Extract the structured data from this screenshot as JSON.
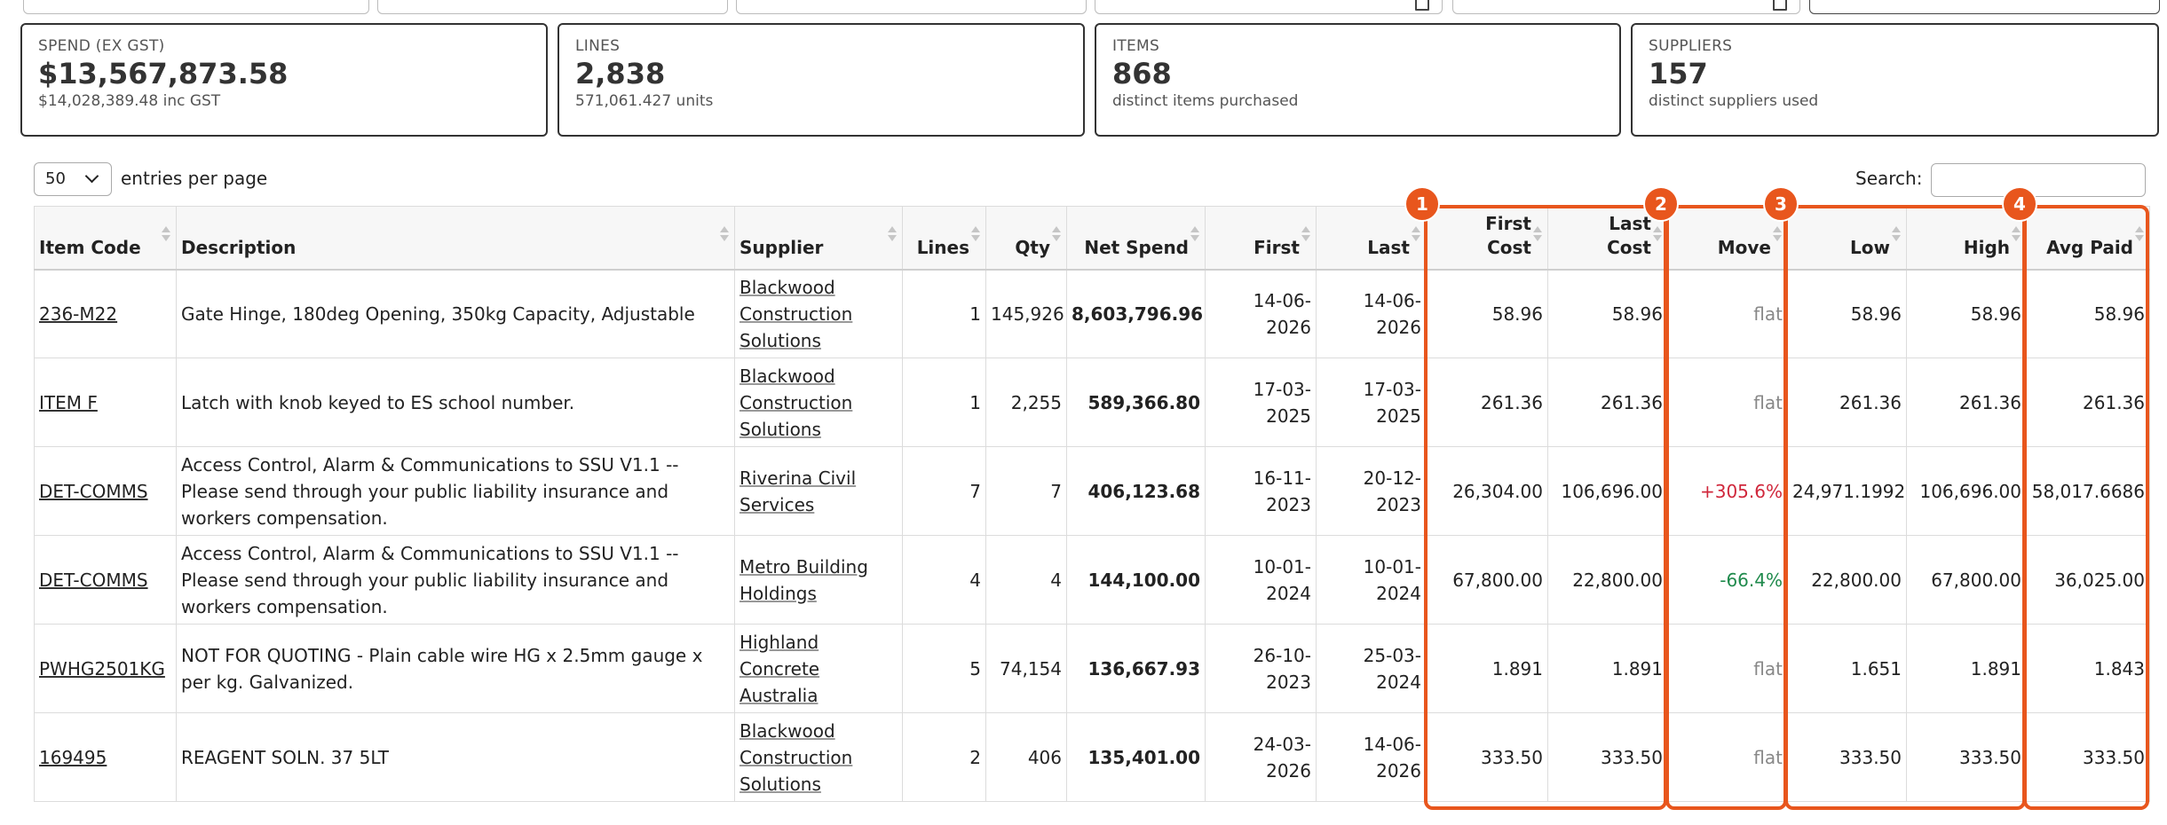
{
  "filters": [
    {
      "value": "",
      "has_calendar": false
    },
    {
      "value": "",
      "has_calendar": false
    },
    {
      "value": "",
      "has_calendar": false
    },
    {
      "value": "",
      "has_calendar": true
    },
    {
      "value": "",
      "has_calendar": true
    },
    {
      "value": "",
      "has_calendar": false
    }
  ],
  "cards": [
    {
      "label": "SPEND (EX GST)",
      "value": "$13,567,873.58",
      "sub": "$14,028,389.48 inc GST"
    },
    {
      "label": "LINES",
      "value": "2,838",
      "sub": "571,061.427 units"
    },
    {
      "label": "ITEMS",
      "value": "868",
      "sub": "distinct items purchased"
    },
    {
      "label": "SUPPLIERS",
      "value": "157",
      "sub": "distinct suppliers used"
    }
  ],
  "table_controls": {
    "page_length": "50",
    "page_length_suffix": "entries per page",
    "search_label": "Search:",
    "search_value": ""
  },
  "table": {
    "headers": [
      {
        "line1": "",
        "line2": "Item Code"
      },
      {
        "line1": "",
        "line2": "Description"
      },
      {
        "line1": "",
        "line2": "Supplier"
      },
      {
        "line1": "",
        "line2": "Lines"
      },
      {
        "line1": "",
        "line2": "Qty"
      },
      {
        "line1": "",
        "line2": "Net Spend"
      },
      {
        "line1": "",
        "line2": "First"
      },
      {
        "line1": "",
        "line2": "Last"
      },
      {
        "line1": "First",
        "line2": "Cost"
      },
      {
        "line1": "Last",
        "line2": "Cost"
      },
      {
        "line1": "",
        "line2": "Move"
      },
      {
        "line1": "",
        "line2": "Low"
      },
      {
        "line1": "",
        "line2": "High"
      },
      {
        "line1": "",
        "line2": "Avg Paid"
      }
    ],
    "rows": [
      {
        "item_code": "236-M22",
        "description": "Gate Hinge, 180deg Opening, 350kg Capacity, Adjustable",
        "supplier": "Blackwood Construction Solutions",
        "lines": "1",
        "qty": "145,926",
        "net_spend": "8,603,796.96",
        "first": "14-06-2026",
        "last": "14-06-2026",
        "first_cost": "58.96",
        "last_cost": "58.96",
        "move": "flat",
        "move_dir": "flat",
        "low": "58.96",
        "high": "58.96",
        "avg_paid": "58.96"
      },
      {
        "item_code": "ITEM F",
        "description": "Latch with knob keyed to ES school number.",
        "supplier": "Blackwood Construction Solutions",
        "lines": "1",
        "qty": "2,255",
        "net_spend": "589,366.80",
        "first": "17-03-2025",
        "last": "17-03-2025",
        "first_cost": "261.36",
        "last_cost": "261.36",
        "move": "flat",
        "move_dir": "flat",
        "low": "261.36",
        "high": "261.36",
        "avg_paid": "261.36"
      },
      {
        "item_code": "DET-COMMS",
        "description": "Access Control, Alarm & Communications to SSU V1.1 -- Please send through your public liability insurance and workers compensation.",
        "supplier": "Riverina Civil Services",
        "lines": "7",
        "qty": "7",
        "net_spend": "406,123.68",
        "first": "16-11-2023",
        "last": "20-12-2023",
        "first_cost": "26,304.00",
        "last_cost": "106,696.00",
        "move": "+305.6%",
        "move_dir": "up",
        "low": "24,971.1992",
        "high": "106,696.00",
        "avg_paid": "58,017.6686"
      },
      {
        "item_code": "DET-COMMS",
        "description": "Access Control, Alarm & Communications to SSU V1.1 -- Please send through your public liability insurance and workers compensation.",
        "supplier": "Metro Building Holdings",
        "lines": "4",
        "qty": "4",
        "net_spend": "144,100.00",
        "first": "10-01-2024",
        "last": "10-01-2024",
        "first_cost": "67,800.00",
        "last_cost": "22,800.00",
        "move": "-66.4%",
        "move_dir": "down",
        "low": "22,800.00",
        "high": "67,800.00",
        "avg_paid": "36,025.00"
      },
      {
        "item_code": "PWHG2501KG",
        "description": "NOT FOR QUOTING - Plain cable wire HG x 2.5mm gauge x per kg. Galvanized.",
        "supplier": "Highland Concrete Australia",
        "lines": "5",
        "qty": "74,154",
        "net_spend": "136,667.93",
        "first": "26-10-2023",
        "last": "25-03-2024",
        "first_cost": "1.891",
        "last_cost": "1.891",
        "move": "flat",
        "move_dir": "flat",
        "low": "1.651",
        "high": "1.891",
        "avg_paid": "1.843"
      },
      {
        "item_code": "169495",
        "description": "REAGENT SOLN. 37 5LT",
        "supplier": "Blackwood Construction Solutions",
        "lines": "2",
        "qty": "406",
        "net_spend": "135,401.00",
        "first": "24-03-2026",
        "last": "14-06-2026",
        "first_cost": "333.50",
        "last_cost": "333.50",
        "move": "flat",
        "move_dir": "flat",
        "low": "333.50",
        "high": "333.50",
        "avg_paid": "333.50"
      }
    ]
  },
  "highlights": [
    {
      "number": "1"
    },
    {
      "number": "2"
    },
    {
      "number": "3"
    },
    {
      "number": "4"
    }
  ],
  "colors": {
    "highlight": "#e8561d",
    "move_up": "#d0283c",
    "move_down": "#1f8a4c",
    "move_flat": "#888888"
  }
}
